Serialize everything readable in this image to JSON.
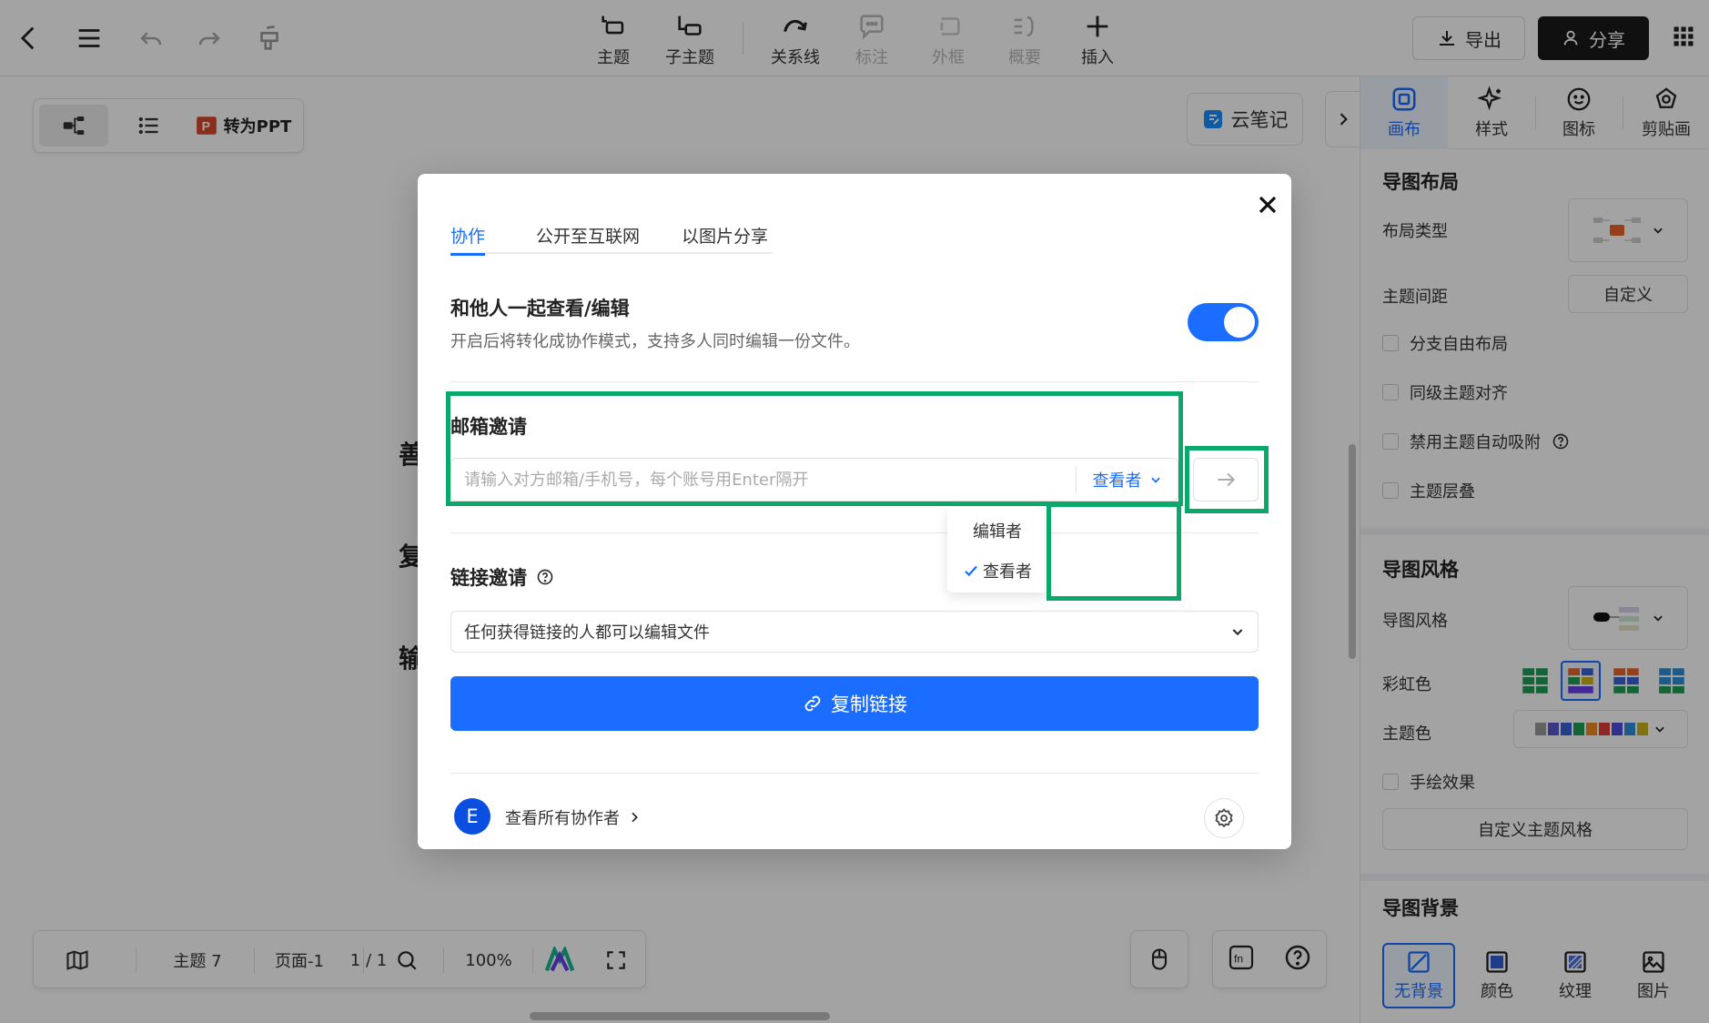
{
  "toolbar": {
    "tools": [
      {
        "label": "主题",
        "icon": "topic-icon",
        "disabled": false
      },
      {
        "label": "子主题",
        "icon": "subtopic-icon",
        "disabled": false
      },
      {
        "label": "关系线",
        "icon": "relation-line-icon",
        "disabled": false
      },
      {
        "label": "标注",
        "icon": "comment-icon",
        "disabled": true
      },
      {
        "label": "外框",
        "icon": "frame-icon",
        "disabled": true
      },
      {
        "label": "概要",
        "icon": "summary-icon",
        "disabled": true
      },
      {
        "label": "插入",
        "icon": "plus-icon",
        "disabled": false
      }
    ],
    "export_label": "导出",
    "share_label": "分享"
  },
  "canvas": {
    "ppt_label": "转为PPT",
    "cloud_note_label": "云笔记",
    "bg_nodes": [
      "善",
      "复",
      "输"
    ]
  },
  "bottombar": {
    "topic_count": "主题 7",
    "page_label": "页面-1",
    "page_count": "1 / 1",
    "zoom": "100%"
  },
  "right_panel": {
    "tabs": [
      {
        "label": "画布",
        "active": true
      },
      {
        "label": "样式",
        "active": false
      },
      {
        "label": "图标",
        "active": false
      },
      {
        "label": "剪贴画",
        "active": false
      }
    ],
    "layout_section": {
      "title": "导图布局",
      "layout_type_label": "布局类型",
      "spacing_label": "主题间距",
      "spacing_value": "自定义",
      "checkboxes": [
        "分支自由布局",
        "同级主题对齐",
        "禁用主题自动吸附",
        "主题层叠"
      ]
    },
    "style_section": {
      "title": "导图风格",
      "style_label": "导图风格",
      "rainbow_label": "彩虹色",
      "theme_color_label": "主题色",
      "theme_colors": [
        "#999999",
        "#5b57d1",
        "#3a62d8",
        "#1f9d55",
        "#f08a24",
        "#e03c3c",
        "#4b4be0",
        "#2f8fd8",
        "#c9b21a"
      ],
      "hand_drawn_label": "手绘效果",
      "custom_style_label": "自定义主题风格"
    },
    "background_section": {
      "title": "导图背景",
      "options": [
        {
          "label": "无背景",
          "active": true
        },
        {
          "label": "颜色",
          "active": false
        },
        {
          "label": "纹理",
          "active": false
        },
        {
          "label": "图片",
          "active": false
        }
      ]
    }
  },
  "modal": {
    "tabs": [
      {
        "label": "协作",
        "active": true
      },
      {
        "label": "公开至互联网",
        "active": false
      },
      {
        "label": "以图片分享",
        "active": false
      }
    ],
    "collab_title": "和他人一起查看/编辑",
    "collab_desc": "开启后将转化成协作模式，支持多人同时编辑一份文件。",
    "collab_enabled": true,
    "email_invite": {
      "title": "邮箱邀请",
      "placeholder": "请输入对方邮箱/手机号，每个账号用Enter隔开",
      "value": "",
      "role": "查看者"
    },
    "role_dropdown": [
      {
        "label": "编辑者",
        "selected": false
      },
      {
        "label": "查看者",
        "selected": true
      }
    ],
    "link_invite": {
      "title": "链接邀请",
      "permission": "任何获得链接的人都可以编辑文件",
      "copy_label": "复制链接"
    },
    "footer": {
      "avatar_letter": "E",
      "view_all_label": "查看所有协作者"
    }
  },
  "colors": {
    "accent": "#1a6dff",
    "annotation": "#0aa86b"
  }
}
